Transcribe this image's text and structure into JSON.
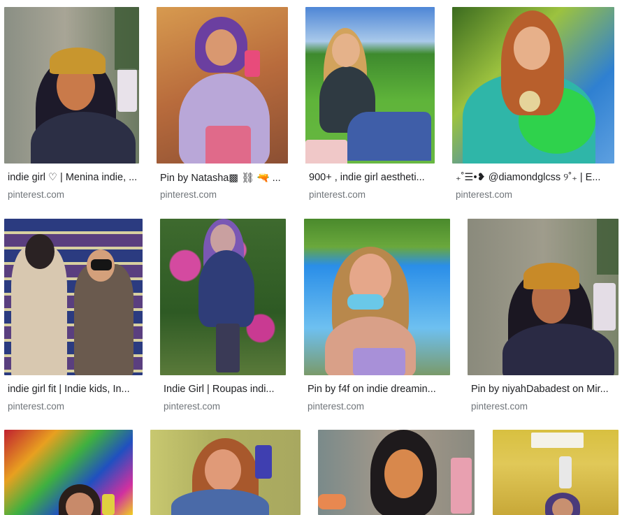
{
  "results": [
    {
      "title": "indie girl ♡ | Menina indie, ...",
      "source": "pinterest.com",
      "image": "person-taking-mirror-selfie-in-bucket-hat"
    },
    {
      "title": "Pin by Natasha▩ ⛓ 🔫 ...",
      "source": "pinterest.com",
      "image": "person-with-purple-hair-mirror-selfie"
    },
    {
      "title": "900+ , indie girl aestheti...",
      "source": "pinterest.com",
      "image": "person-sitting-on-grass"
    },
    {
      "title": "₊˚☰•❥ @diamondglcss ୨˚₊ | E...",
      "source": "pinterest.com",
      "image": "person-in-green-hoodie-outdoors"
    },
    {
      "title": "indie girl fit | Indie kids, In...",
      "source": "pinterest.com",
      "image": "two-people-mirror-selfie-in-store"
    },
    {
      "title": "Indie Girl | Roupas indi...",
      "source": "pinterest.com",
      "image": "person-standing-by-flowering-bush"
    },
    {
      "title": "Pin by f4f on indie dreamin...",
      "source": "pinterest.com",
      "image": "person-outdoors-under-blue-sky"
    },
    {
      "title": "Pin by niyahDabadest on Mir...",
      "source": "pinterest.com",
      "image": "person-mirror-selfie-in-bucket-hat"
    },
    {
      "title": "",
      "source": "",
      "image": "colorful-mirror-selfie-with-posters"
    },
    {
      "title": "",
      "source": "",
      "image": "person-with-phone-selfie"
    },
    {
      "title": "",
      "source": "",
      "image": "person-mirror-selfie-pink-phone"
    },
    {
      "title": "",
      "source": "",
      "image": "person-in-room-with-ceiling-light"
    }
  ],
  "colors": {
    "title_text": "#202124",
    "source_text": "#70757a",
    "background": "#ffffff"
  }
}
